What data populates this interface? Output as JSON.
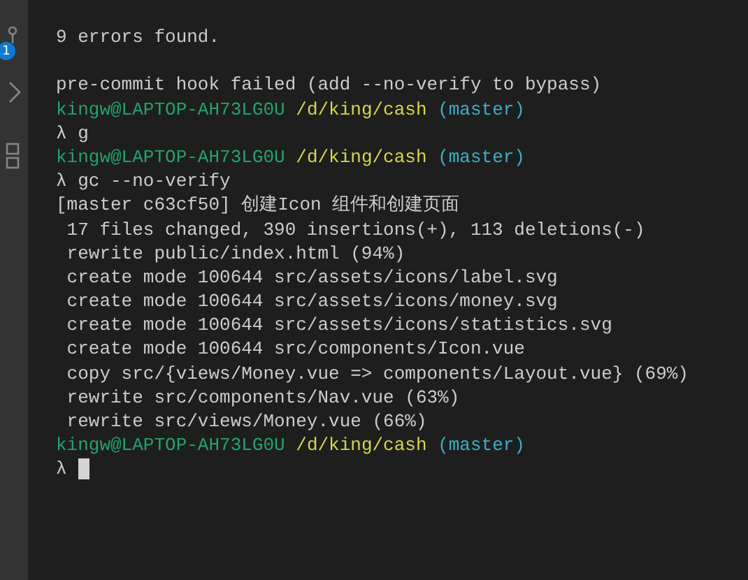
{
  "sidebar": {
    "badge": "1"
  },
  "terminal": {
    "lines": [
      {
        "kind": "output",
        "text": "9 errors found."
      },
      {
        "kind": "blank"
      },
      {
        "kind": "output",
        "text": "pre-commit hook failed (add --no-verify to bypass)"
      },
      {
        "kind": "prompt",
        "user": "kingw@LAPTOP-AH73LG0U",
        "path": "/d/king/cash",
        "branch": "(master)"
      },
      {
        "kind": "command",
        "symbol": "λ",
        "text": "g"
      },
      {
        "kind": "prompt",
        "user": "kingw@LAPTOP-AH73LG0U",
        "path": "/d/king/cash",
        "branch": "(master)"
      },
      {
        "kind": "command",
        "symbol": "λ",
        "text": "gc --no-verify"
      },
      {
        "kind": "output",
        "text": "[master c63cf50] 创建Icon 组件和创建页面"
      },
      {
        "kind": "output",
        "text": " 17 files changed, 390 insertions(+), 113 deletions(-)"
      },
      {
        "kind": "output",
        "text": " rewrite public/index.html (94%)"
      },
      {
        "kind": "output",
        "text": " create mode 100644 src/assets/icons/label.svg"
      },
      {
        "kind": "output",
        "text": " create mode 100644 src/assets/icons/money.svg"
      },
      {
        "kind": "output",
        "text": " create mode 100644 src/assets/icons/statistics.svg"
      },
      {
        "kind": "output",
        "text": " create mode 100644 src/components/Icon.vue"
      },
      {
        "kind": "output",
        "text": " copy src/{views/Money.vue => components/Layout.vue} (69%)"
      },
      {
        "kind": "output",
        "text": " rewrite src/components/Nav.vue (63%)"
      },
      {
        "kind": "output",
        "text": " rewrite src/views/Money.vue (66%)"
      },
      {
        "kind": "prompt",
        "user": "kingw@LAPTOP-AH73LG0U",
        "path": "/d/king/cash",
        "branch": "(master)"
      },
      {
        "kind": "input",
        "symbol": "λ"
      }
    ]
  }
}
